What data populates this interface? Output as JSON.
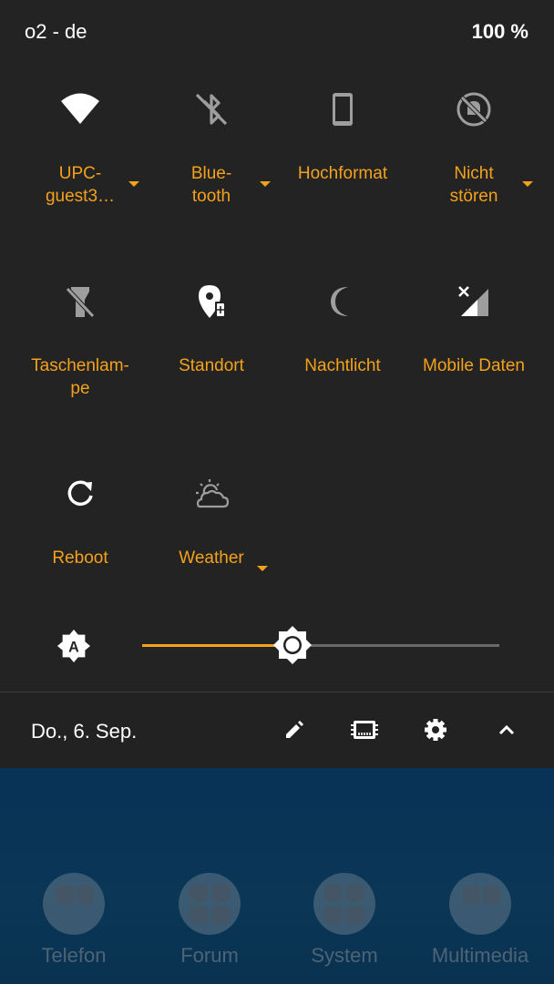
{
  "status_bar": {
    "carrier": "o2 - de",
    "battery": "100 %"
  },
  "quick_settings": {
    "tiles": [
      {
        "label": "UPC-\nguest3…",
        "icon": "wifi-icon",
        "has_dropdown": true
      },
      {
        "label": "Blue-\ntooth",
        "icon": "bluetooth-off-icon",
        "has_dropdown": true
      },
      {
        "label": "Hochformat",
        "icon": "portrait-rotation-icon",
        "has_dropdown": false
      },
      {
        "label": "Nicht\nstören",
        "icon": "do-not-disturb-icon",
        "has_dropdown": true
      },
      {
        "label": "Taschenlam-\npe",
        "icon": "flashlight-off-icon",
        "has_dropdown": false
      },
      {
        "label": "Standort",
        "icon": "location-icon",
        "has_dropdown": false
      },
      {
        "label": "Nachtlicht",
        "icon": "night-light-icon",
        "has_dropdown": false
      },
      {
        "label": "Mobile Daten",
        "icon": "mobile-data-off-icon",
        "has_dropdown": false
      },
      {
        "label": "Reboot",
        "icon": "reboot-icon",
        "has_dropdown": false
      },
      {
        "label": "Weather",
        "icon": "weather-icon",
        "has_dropdown": true
      }
    ],
    "brightness": {
      "level": 0.42,
      "auto": true
    }
  },
  "footer": {
    "date": "Do., 6. Sep.",
    "icons": [
      "edit-icon",
      "memory-icon",
      "settings-icon",
      "collapse-icon"
    ]
  },
  "home_folders": [
    {
      "label": "Telefon"
    },
    {
      "label": "Forum"
    },
    {
      "label": "System"
    },
    {
      "label": "Multimedia"
    }
  ],
  "colors": {
    "accent": "#f4a21c",
    "panel": "#232323",
    "icon_active": "#ffffff",
    "icon_inactive": "#9e9e9e"
  }
}
